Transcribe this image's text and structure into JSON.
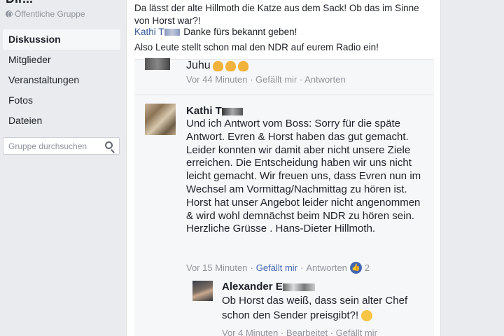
{
  "sidebar": {
    "group_title": "Dir...",
    "group_type": "Öffentliche Gruppe",
    "items": [
      {
        "label": "Diskussion"
      },
      {
        "label": "Mitglieder"
      },
      {
        "label": "Veranstaltungen"
      },
      {
        "label": "Fotos"
      },
      {
        "label": "Dateien"
      }
    ],
    "search_placeholder": "Gruppe durchsuchen"
  },
  "post": {
    "text": "Da lässt der alte Hillmoth die Katze aus dem Sack! Ob das im Sinne von Horst war?!",
    "mention_name": "Kathi T",
    "mention_suffix": "Danke fürs bekannt geben!",
    "line3": "Also Leute stellt schon mal den NDR auf eurem Radio ein!"
  },
  "comments": [
    {
      "text": "Juhu",
      "time": "Vor 44 Minuten",
      "like": "Gefällt mir",
      "reply": "Antworten"
    },
    {
      "name": "Kathi T",
      "body": "Und ich Antwort vom Boss: Sorry für die späte Antwort. Evren & Horst haben das gut gemacht. Leider konnten wir damit aber nicht unsere Ziele erreichen. Die Entscheidung haben wir uns nicht leicht gemacht. Wir freuen uns, dass Evren nun im Wechsel am Vormittag/Nachmittag zu hören ist. Horst hat unser Angebot leider nicht angenommen & wird wohl demnächst beim NDR zu hören sein. Herzliche Grüsse . Hans-Dieter Hillmoth.",
      "time": "Vor 15 Minuten",
      "like": "Gefällt mir",
      "reply": "Antworten",
      "like_count": "2"
    },
    {
      "name": "Alexander E",
      "body": "Ob Horst das weiß, dass sein alter Chef schon den Sender preisgibt?!",
      "time": "Vor 4 Minuten",
      "edited": "Bearbeitet",
      "like": "Gefällt mir"
    }
  ],
  "sep": "·",
  "colors": {
    "link": "#365899",
    "like_active": "#4267b2",
    "meta": "#90949c"
  }
}
